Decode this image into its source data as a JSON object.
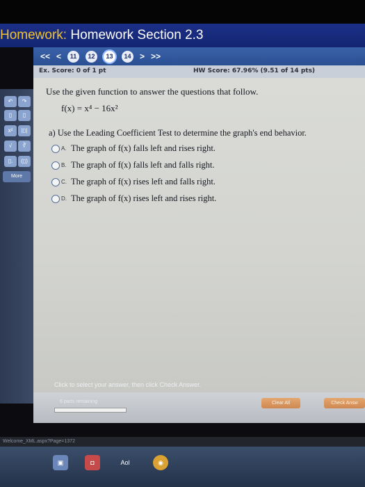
{
  "window": {
    "title_prefix": "Homework:",
    "title": "Homework Section 2.3"
  },
  "nav": {
    "first": "<<",
    "prev": "<",
    "next": ">",
    "last": ">>",
    "questions": [
      "11",
      "12",
      "13",
      "14"
    ],
    "current_question": "13"
  },
  "score": {
    "ex_score": "Ex. Score: 0 of 1 pt",
    "hw_score": "HW Score: 67.96% (9.51 of 14 pts)"
  },
  "problem": {
    "instruction": "Use the given function to answer the questions that follow.",
    "function": "f(x) = x⁴ − 16x²",
    "part_a": "a) Use the Leading Coefficient Test to determine the graph's end behavior.",
    "choices": [
      {
        "letter": "A.",
        "text": "The graph of f(x) falls left and rises right."
      },
      {
        "letter": "B.",
        "text": "The graph of f(x) falls left and falls right."
      },
      {
        "letter": "C.",
        "text": "The graph of f(x) rises left and falls right."
      },
      {
        "letter": "D.",
        "text": "The graph of f(x) rises left and rises right."
      }
    ]
  },
  "sidebar": {
    "more_label": "More"
  },
  "footer": {
    "hint": "Click to select your answer, then click Check Answer.",
    "parts_remaining": "6 parts remaining",
    "clear_all": "Clear All",
    "check_answer": "Check Answ"
  },
  "status": {
    "url_text": "Welcome_XML.aspx?Page=1372"
  },
  "taskbar": {
    "apps": [
      "aol-icon"
    ],
    "aol_label": "Aol"
  },
  "colors": {
    "title_bar": "#1b2f86",
    "nav_bar": "#3a62a8",
    "content_bg": "#d6d7d3",
    "button_orange": "#d08852"
  }
}
